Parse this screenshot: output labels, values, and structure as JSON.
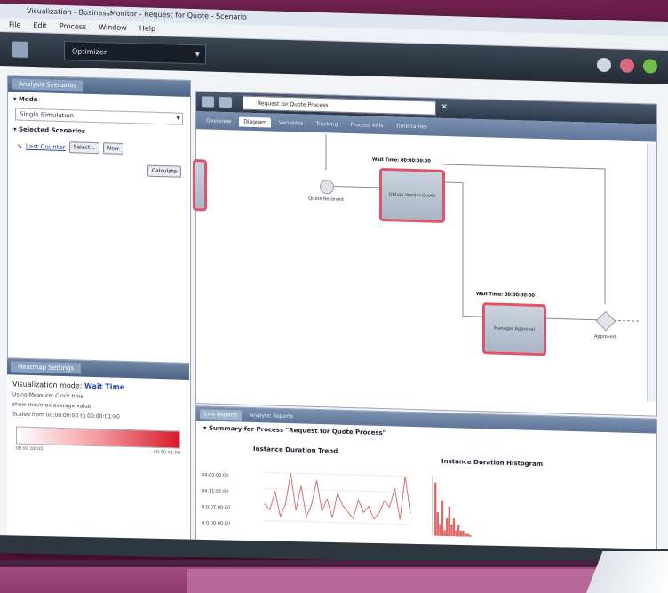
{
  "window": {
    "title": "Visualization - BusinessMonitor - Request for Quote - Scenario",
    "menu": [
      "File",
      "Edit",
      "Process",
      "Window",
      "Help"
    ]
  },
  "toolbar": {
    "perspective": "Optimizer"
  },
  "left_panel": {
    "tab": "Analysis Scenarios",
    "mode_label": "Mode",
    "mode_value": "Single Simulation",
    "selected_label": "Selected Scenarios",
    "scenario_link": "Last Counter",
    "select_button": "Select...",
    "new_button": "New",
    "calculate_button": "Calculate"
  },
  "viz_panel": {
    "tab": "Heatmap Settings",
    "mode_prefix": "Visualization mode:",
    "mode_value": "Wait Time",
    "note1": "Using Measure: Clock time",
    "note2": "show min/max average value",
    "note3": "Scaled from 00:00:00:00 to 00:00:01:00",
    "range_min": "00:00:00:00",
    "range_max": "00:00:01:00"
  },
  "editor": {
    "document": "Request for Quote Process",
    "tabs": [
      "Overview",
      "Diagram",
      "Variables",
      "Tracking",
      "Process KPIs",
      "Timeframes"
    ],
    "active_tab": "Diagram",
    "nodes": {
      "start_label": "Quote Received",
      "task1": "Obtain Vendor Quote",
      "task1_wait": "Wait Time: 00:00:00:00",
      "task2": "Manager Approval",
      "task2_wait": "Wait Time: 00:00:00:00",
      "gateway_label": "Approved"
    }
  },
  "bottom_panel": {
    "tabs": [
      "Live Reports",
      "Analytic Reports"
    ],
    "summary": "Summary for Process \"Request for Quote Process\"",
    "chart1_title": "Instance Duration Trend",
    "chart2_title": "Instance Duration Histogram",
    "chart1_ticks": [
      "04:00:00:00",
      "04:11:00:00",
      "0:0:07:00:00",
      "0:0:00:00:00"
    ]
  },
  "colors": {
    "accent_red": "#e0546a",
    "chart_line": "#d87070",
    "histogram": "#e06a6a"
  },
  "chart_data": [
    {
      "type": "line",
      "title": "Instance Duration Trend",
      "series": [
        {
          "values": [
            3,
            2,
            5,
            1,
            3,
            8,
            2,
            6,
            1,
            3,
            7,
            2,
            4,
            1,
            5,
            3,
            2,
            1,
            4,
            2,
            3,
            1,
            2,
            4,
            3,
            6,
            1,
            8,
            2
          ]
        }
      ]
    },
    {
      "type": "bar",
      "title": "Instance Duration Histogram",
      "values": [
        9,
        4,
        2,
        6,
        1,
        3,
        5,
        2,
        3,
        1,
        2,
        1,
        1,
        0.5,
        0.5,
        0.3
      ]
    }
  ]
}
